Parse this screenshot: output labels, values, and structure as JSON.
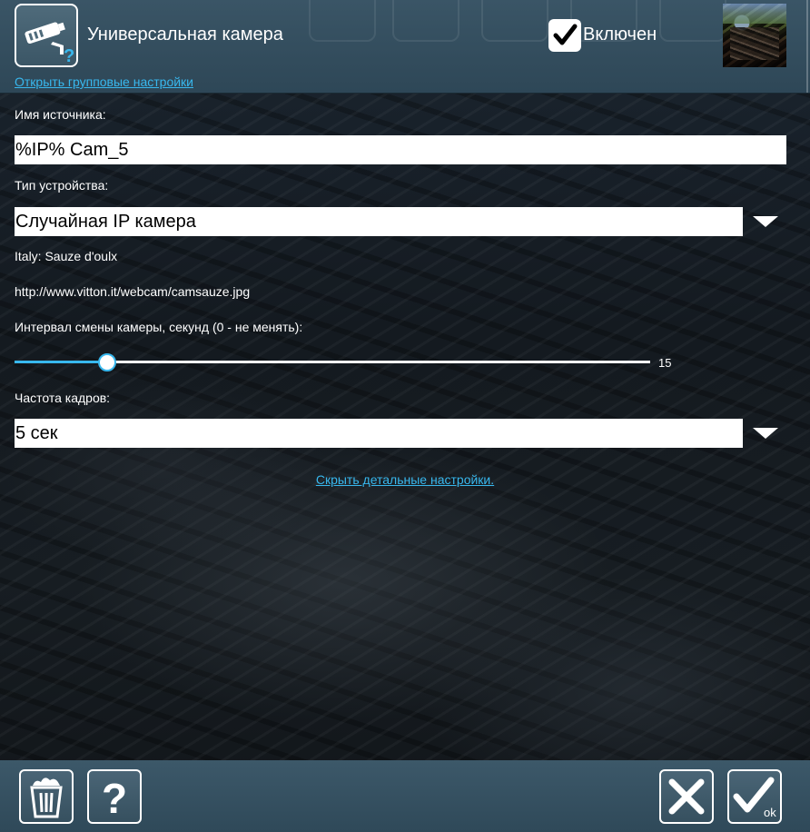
{
  "header": {
    "title": "Универсальная камера",
    "group_settings_link": "Открыть групповые настройки",
    "enabled_label": "Включен",
    "enabled_checked": true,
    "camera_icon": "surveillance-camera-icon",
    "help_overlay_icon": "question-mark-icon"
  },
  "form": {
    "source_name_label": "Имя источника:",
    "source_name_value": "%IP% Cam_5",
    "device_type_label": "Тип устройства:",
    "device_type_value": "Случайная IP камера",
    "camera_location": "Italy: Sauze d'oulx",
    "camera_url": "http://www.vitton.it/webcam/camsauze.jpg",
    "interval_label": "Интервал смены камеры, секунд (0 - не менять):",
    "interval_value": "15",
    "interval_fraction": 0.146,
    "frame_rate_label": "Частота кадров:",
    "frame_rate_value": "5 сек",
    "hide_details_link": "Скрыть детальные настройки."
  },
  "footer": {
    "delete_icon": "trash-bin-icon",
    "help_icon": "question-mark-icon",
    "cancel_icon": "close-x-icon",
    "ok_icon": "checkmark-icon",
    "ok_label": "ok"
  },
  "colors": {
    "accent": "#38b8ee",
    "header_bg": "#3a5566",
    "footer_bg": "#3c5869",
    "field_bg": "#ffffff"
  }
}
